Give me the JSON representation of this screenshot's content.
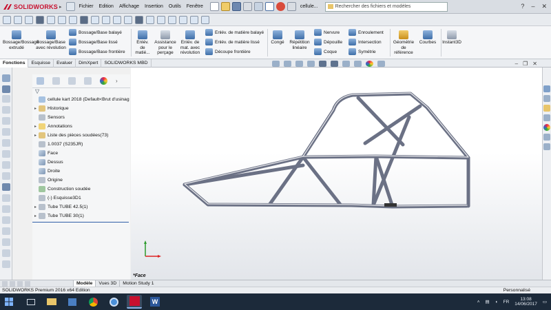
{
  "app": {
    "brand": "SOLIDWORKS",
    "filename": "cellule...",
    "search_placeholder": "Rechercher des fichiers et modèles"
  },
  "menu": [
    "Fichier",
    "Edition",
    "Affichage",
    "Insertion",
    "Outils",
    "Fenêtre"
  ],
  "ribbon": {
    "bossage_extrude": "Bossage/Bossage extrudé",
    "bossage_revolution": "Bossage/Base avec révolution",
    "bossage_balaye": "Bossage/Base balayé",
    "bossage_lisse": "Bossage/Base lissé",
    "bossage_frontiere": "Bossage/Base frontière",
    "enlev_matiere": "Enlév. de matié...",
    "assistance_percage": "Assistance pour le perçage",
    "enlev_revolution": "Enlév. de mat. avec révolution",
    "enlev_balaye": "Enlév. de matière balayé",
    "enlev_lisse": "Enlév. de matière lissé",
    "decoupe_frontiere": "Découpe frontière",
    "conge": "Congé",
    "repetition": "Répétition linéaire",
    "nervure": "Nervure",
    "depouille": "Dépouille",
    "coque": "Coque",
    "enroulement": "Enroulement",
    "intersection": "Intersection",
    "symetrie": "Symétrie",
    "geometrie": "Géométrie de référence",
    "courbes": "Courbes",
    "instant3d": "Instant3D"
  },
  "tabs": [
    "Fonctions",
    "Esquisse",
    "Evaluer",
    "DimXpert",
    "SOLIDWORKS MBD"
  ],
  "tree": [
    {
      "label": "cellule kart 2018  (Default<Brut d'usinag",
      "icon": "tree"
    },
    {
      "label": "Historique",
      "icon": "folder"
    },
    {
      "label": "Sensors",
      "icon": "grey"
    },
    {
      "label": "Annotations",
      "icon": "yellow"
    },
    {
      "label": "Liste des pièces soudées(73)",
      "icon": "folder"
    },
    {
      "label": "1.0037 (S235JR)",
      "icon": "grey"
    },
    {
      "label": "Face",
      "icon": "plane"
    },
    {
      "label": "Dessus",
      "icon": "plane"
    },
    {
      "label": "Droite",
      "icon": "plane"
    },
    {
      "label": "Origine",
      "icon": "grey"
    },
    {
      "label": "Construction soudée",
      "icon": "green"
    },
    {
      "label": "(-) Esquisse3D1",
      "icon": "grey"
    },
    {
      "label": "Tube TUBE 42.5(1)",
      "icon": "grey"
    },
    {
      "label": "Tube TUBE 30(1)",
      "icon": "grey"
    }
  ],
  "viewport": {
    "view_label": "*Face"
  },
  "bottom_tabs": [
    "Modèle",
    "Vues 3D",
    "Motion Study 1"
  ],
  "status": {
    "edition": "SOLIDWORKS Premium 2016 x64 Edition",
    "units": "Personnalisé"
  },
  "taskbar": {
    "lang": "FR",
    "time": "13:08",
    "date": "14/06/2017"
  },
  "colors": {
    "brand_red": "#c8102e",
    "frame": "#6b7185",
    "taskbar": "#1c2a3a"
  }
}
